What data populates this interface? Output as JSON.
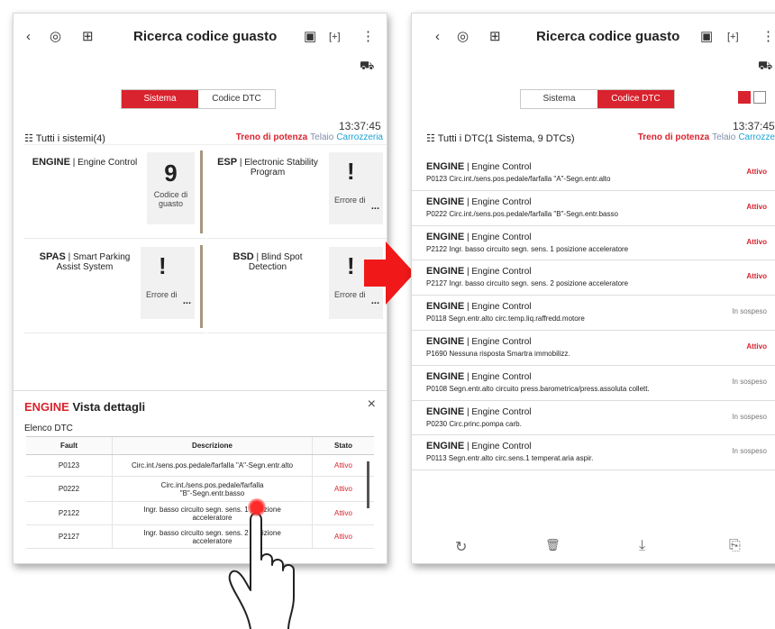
{
  "left": {
    "title": "Ricerca codice guasto",
    "tabs": [
      "Sistema",
      "Codice DTC"
    ],
    "active_tab": 0,
    "time": "13:37:45",
    "all_systems": "Tutti i sistemi(4)",
    "categories": [
      "Treno di potenza",
      "Telaio",
      "Carrozzeria"
    ],
    "systems": [
      {
        "name_bold": "ENGINE",
        "name_rest": "Engine Control",
        "kind": "count",
        "count": "9",
        "sub": "Codice di guasto"
      },
      {
        "name_bold": "ESP",
        "name_rest": "Electronic Stability Program",
        "kind": "error",
        "symbol": "!",
        "sub": "Errore di",
        "dots": "..."
      },
      {
        "name_bold": "SPAS",
        "name_rest": "Smart Parking Assist System",
        "kind": "error",
        "symbol": "!",
        "sub": "Errore di",
        "dots": "..."
      },
      {
        "name_bold": "BSD",
        "name_rest": "Blind Spot Detection",
        "kind": "error",
        "symbol": "!",
        "sub": "Errore di",
        "dots": "..."
      }
    ],
    "detail": {
      "title_red": "ENGINE",
      "title_rest": "Vista dettagli",
      "close": "×",
      "list_label": "Elenco DTC",
      "headers": [
        "Fault",
        "Descrizione",
        "Stato"
      ],
      "rows": [
        {
          "fault": "P0123",
          "desc": "Circ.int./sens.pos.pedale/farfalla \"A\"-Segn.entr.alto",
          "status": "Attivo"
        },
        {
          "fault": "P0222",
          "desc": "Circ.int./sens.pos.pedale/farfalla \"B\"-Segn.entr.basso",
          "status": "Attivo"
        },
        {
          "fault": "P2122",
          "desc": "Ingr. basso circuito segn. sens. 1 posizione acceleratore",
          "status": "Attivo"
        },
        {
          "fault": "P2127",
          "desc": "Ingr. basso circuito segn. sens. 2 posizione acceleratore",
          "status": "Attivo"
        }
      ]
    }
  },
  "right": {
    "title": "Ricerca codice guasto",
    "tabs": [
      "Sistema",
      "Codice DTC"
    ],
    "active_tab": 1,
    "time": "13:37:45",
    "all_dtc": "Tutti i DTC(1 Sistema, 9 DTCs)",
    "categories": [
      "Treno di potenza",
      "Telaio",
      "Carrozzeria"
    ],
    "items": [
      {
        "sys_bold": "ENGINE",
        "sys_rest": "Engine Control",
        "desc": "P0123 Circ.int./sens.pos.pedale/farfalla \"A\"-Segn.entr.alto",
        "status": "Attivo",
        "active": true
      },
      {
        "sys_bold": "ENGINE",
        "sys_rest": "Engine Control",
        "desc": "P0222 Circ.int./sens.pos.pedale/farfalla \"B\"-Segn.entr.basso",
        "status": "Attivo",
        "active": true
      },
      {
        "sys_bold": "ENGINE",
        "sys_rest": "Engine Control",
        "desc": "P2122 Ingr. basso circuito segn. sens. 1 posizione acceleratore",
        "status": "Attivo",
        "active": true
      },
      {
        "sys_bold": "ENGINE",
        "sys_rest": "Engine Control",
        "desc": "P2127 Ingr. basso circuito segn. sens. 2 posizione acceleratore",
        "status": "Attivo",
        "active": true
      },
      {
        "sys_bold": "ENGINE",
        "sys_rest": "Engine Control",
        "desc": "P0118 Segn.entr.alto circ.temp.liq.raffredd.motore",
        "status": "In sospeso",
        "active": false
      },
      {
        "sys_bold": "ENGINE",
        "sys_rest": "Engine Control",
        "desc": "P1690 Nessuna risposta Smartra immobilizz.",
        "status": "Attivo",
        "active": true
      },
      {
        "sys_bold": "ENGINE",
        "sys_rest": "Engine Control",
        "desc": "P0108 Segn.entr.alto circuito press.barometrica/press.assoluta collett.",
        "status": "In sospeso",
        "active": false
      },
      {
        "sys_bold": "ENGINE",
        "sys_rest": "Engine Control",
        "desc": "P0230 Circ.princ.pompa carb.",
        "status": "In sospeso",
        "active": false
      },
      {
        "sys_bold": "ENGINE",
        "sys_rest": "Engine Control",
        "desc": "P0113 Segn.entr.alto circ.sens.1 temperat.aria aspir.",
        "status": "In sospeso",
        "active": false
      }
    ]
  },
  "icons": {
    "back": "‹",
    "scan": "◎",
    "add_file": "⊞",
    "car_battery": "▣",
    "crop": "[+]",
    "more": "⋮",
    "car": "⛟",
    "filter": "☷",
    "refresh": "↻",
    "delete": "🗑",
    "download": "⤓",
    "export": "⎘"
  },
  "colors": {
    "accent": "#d9232e",
    "category_gray": "#7e8ea8",
    "category_blue": "#1aa3d6"
  }
}
